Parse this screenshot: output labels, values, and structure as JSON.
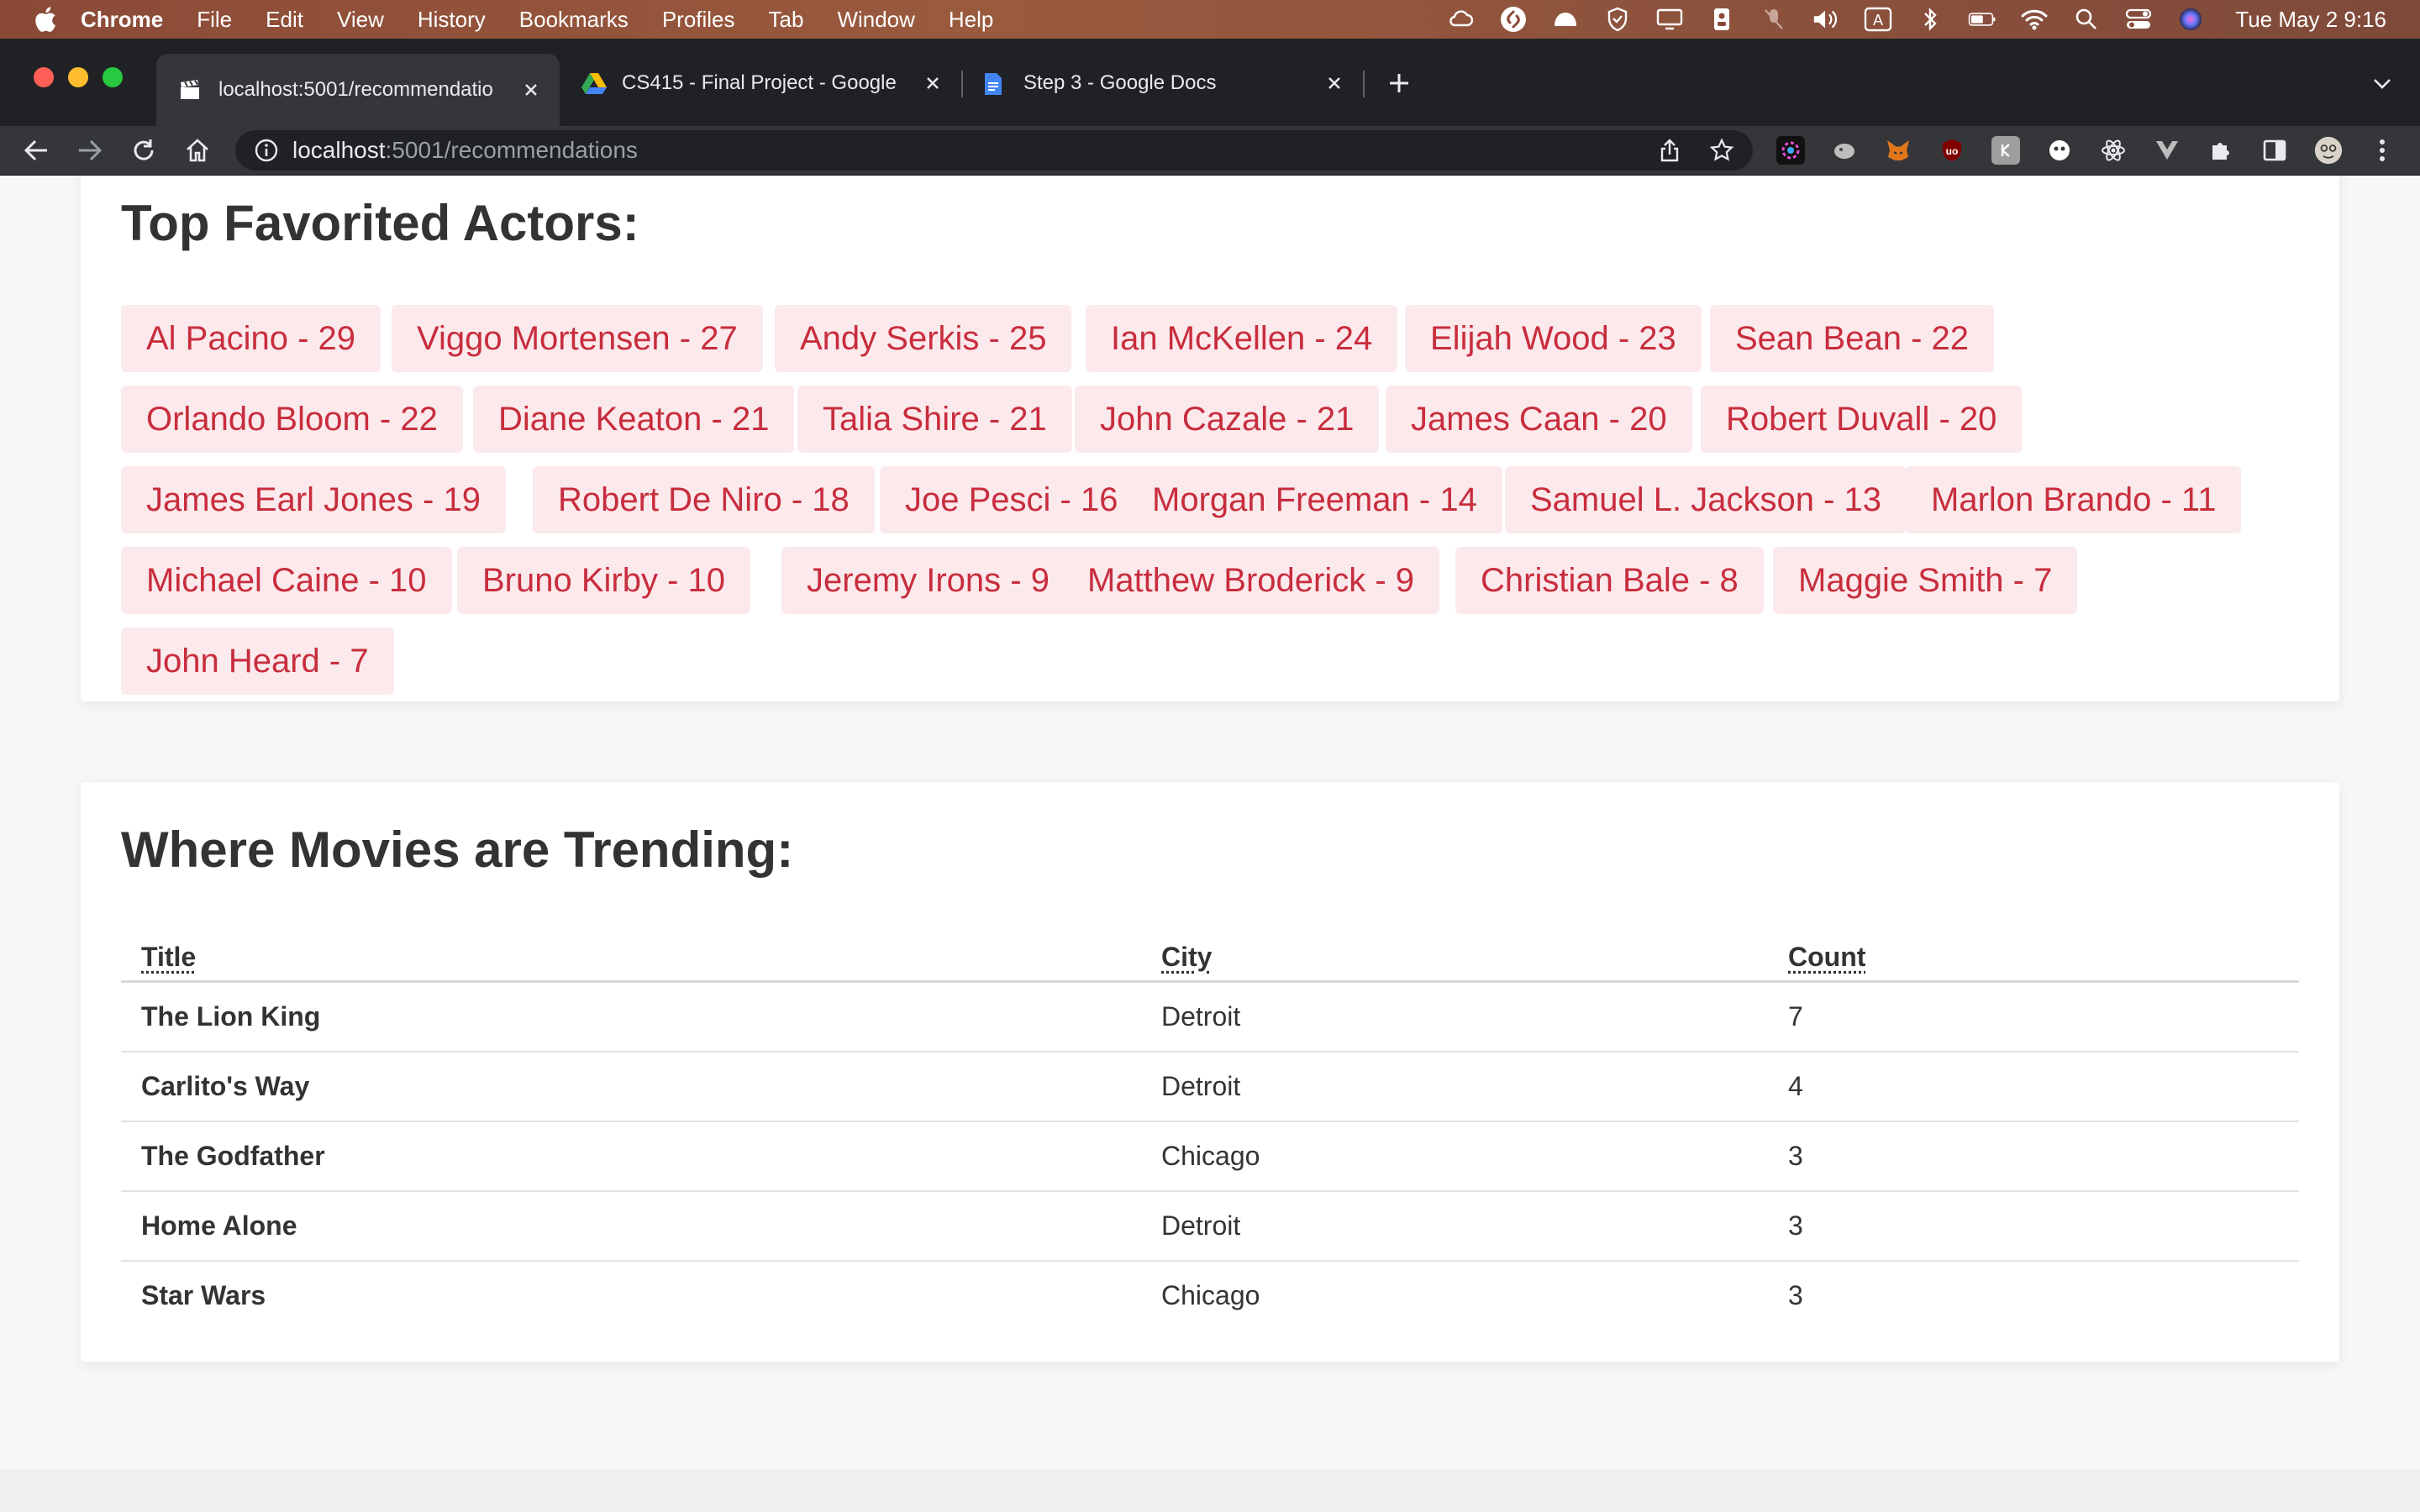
{
  "menubar": {
    "app": "Chrome",
    "items": [
      "File",
      "Edit",
      "View",
      "History",
      "Bookmarks",
      "Profiles",
      "Tab",
      "Window",
      "Help"
    ],
    "clock": "Tue May 2  9:16"
  },
  "tabs": [
    {
      "title": "localhost:5001/recommendatio",
      "favicon": "clapper-icon",
      "active": true
    },
    {
      "title": "CS415 - Final Project - Google",
      "favicon": "google-drive-icon",
      "active": false
    },
    {
      "title": "Step 3 - Google Docs",
      "favicon": "google-docs-icon",
      "active": false
    }
  ],
  "toolbar": {
    "url_host": "localhost",
    "url_path": ":5001/recommendations"
  },
  "actors_section": {
    "heading": "Top Favorited Actors:",
    "actors": [
      "Al Pacino - 29",
      "Viggo Mortensen - 27",
      "Andy Serkis - 25",
      "Ian McKellen - 24",
      "Elijah Wood - 23",
      "Sean Bean - 22",
      "Orlando Bloom - 22",
      "Diane Keaton - 21",
      "Talia Shire - 21",
      "John Cazale - 21",
      "James Caan - 20",
      "Robert Duvall - 20",
      "James Earl Jones - 19",
      "Robert De Niro - 18",
      "Joe Pesci - 16",
      "Morgan Freeman - 14",
      "Samuel L. Jackson - 13",
      "Marlon Brando - 11",
      "Michael Caine - 10",
      "Bruno Kirby - 10",
      "Jeremy Irons - 9",
      "Matthew Broderick - 9",
      "Christian Bale - 8",
      "Maggie Smith - 7",
      "John Heard - 7"
    ]
  },
  "trending_section": {
    "heading": "Where Movies are Trending:",
    "columns": [
      "Title",
      "City",
      "Count"
    ],
    "rows": [
      {
        "title": "The Lion King",
        "city": "Detroit",
        "count": "7"
      },
      {
        "title": "Carlito's Way",
        "city": "Detroit",
        "count": "4"
      },
      {
        "title": "The Godfather",
        "city": "Chicago",
        "count": "3"
      },
      {
        "title": "Home Alone",
        "city": "Detroit",
        "count": "3"
      },
      {
        "title": "Star Wars",
        "city": "Chicago",
        "count": "3"
      }
    ]
  },
  "colors": {
    "chip_bg": "#fbe9ec",
    "chip_text": "#c82d3d",
    "heading_text": "#333333"
  }
}
